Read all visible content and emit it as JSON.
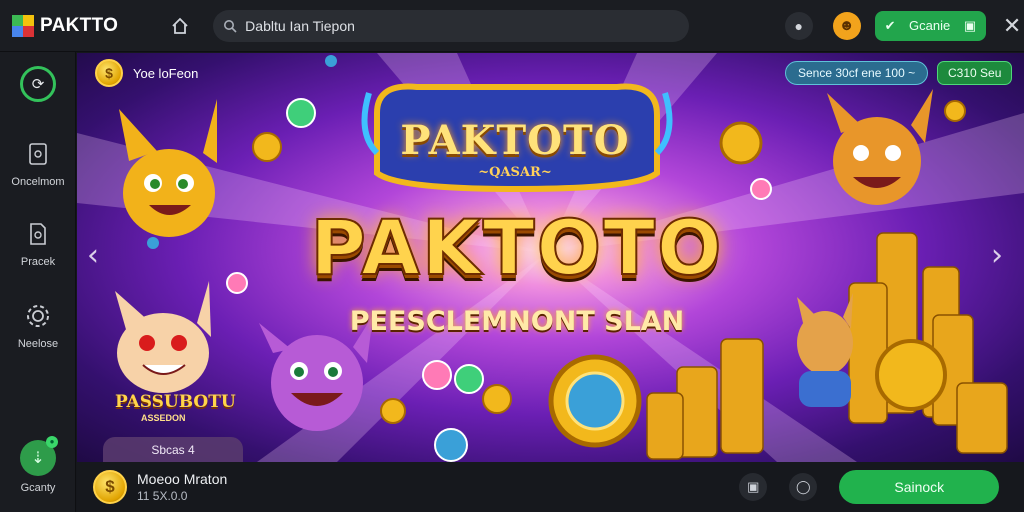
{
  "app": {
    "name": "PAKTTO"
  },
  "search": {
    "placeholder": "Dabltu Ian Tiepon"
  },
  "header": {
    "action_label": "Gcanie"
  },
  "sidebar": {
    "items": [
      {
        "label": ""
      },
      {
        "label": "Oncelmom"
      },
      {
        "label": "Pracek"
      },
      {
        "label": "Neelose"
      },
      {
        "label": "Gcanty"
      }
    ]
  },
  "banner": {
    "top_left_label": "Yoe loFeon",
    "pill_info": "Sence 30cf ene 100 ~",
    "pill_action": "C310 Seu",
    "emblem_title": "PAKTOTO",
    "emblem_sub": "~QASAR~",
    "title": "PAKTOTO",
    "subtitle": "PEESCLEMNONT SLAN",
    "character_label": "PASSUBOTU",
    "character_sub": "ASSEDON",
    "tag_label": "Sbcas 4"
  },
  "bottom": {
    "title": "Moeoo Mraton",
    "subtitle": "11 5X.0.0",
    "button_label": "Sainock"
  },
  "icons": {
    "home": "home-icon",
    "search": "search-icon",
    "close": "close-icon"
  },
  "colors": {
    "accent_green": "#22a54c",
    "gold": "#ffd34d",
    "background": "#15171c"
  }
}
